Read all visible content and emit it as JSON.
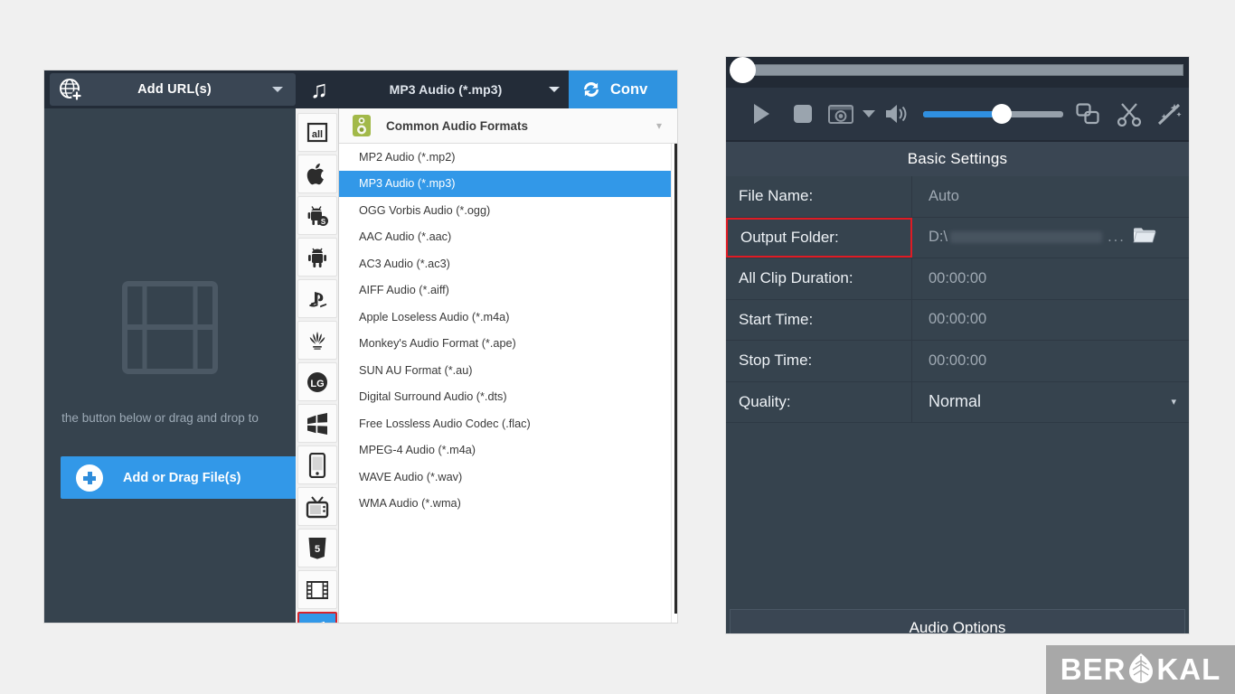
{
  "left_window": {
    "add_url_button": {
      "label": "Add URL(s)",
      "icon": "globe-add-icon",
      "caret": "chevron-down-icon"
    },
    "format_bar": {
      "icon": "music-note-icon",
      "selected_format": "MP3 Audio (*.mp3)",
      "caret": "chevron-down-icon",
      "convert_label": "Conv",
      "convert_icon": "sync-refresh-icon",
      "convert_color": "#2f93e0"
    },
    "dropzone": {
      "icon": "film-strip-icon",
      "hint_text": "the button below or drag and drop to",
      "add_button_label": "Add or Drag File(s)",
      "add_button_color": "#3298e8"
    },
    "category_rail": [
      {
        "name": "all-formats",
        "icon": "all-icon",
        "selected": false
      },
      {
        "name": "apple",
        "icon": "apple-icon",
        "selected": false
      },
      {
        "name": "samsung",
        "icon": "samsung-android-icon",
        "selected": false
      },
      {
        "name": "android",
        "icon": "android-icon",
        "selected": false
      },
      {
        "name": "playstation",
        "icon": "playstation-icon",
        "selected": false
      },
      {
        "name": "huawei",
        "icon": "huawei-icon",
        "selected": false
      },
      {
        "name": "lg",
        "icon": "lg-icon",
        "selected": false
      },
      {
        "name": "windows",
        "icon": "windows-flag-icon",
        "selected": false
      },
      {
        "name": "mobile-phone",
        "icon": "smartphone-icon",
        "selected": false
      },
      {
        "name": "tv",
        "icon": "television-icon",
        "selected": false
      },
      {
        "name": "html5",
        "icon": "html5-icon",
        "selected": false
      },
      {
        "name": "video",
        "icon": "film-strip-icon",
        "selected": false
      },
      {
        "name": "audio",
        "icon": "music-note-icon",
        "selected": true
      }
    ],
    "format_group": {
      "title": "Common Audio Formats",
      "icon": "green-speaker-icon",
      "collapse_caret": "chevron-down-icon"
    },
    "formats": [
      {
        "label": "MP2 Audio (*.mp2)",
        "selected": false
      },
      {
        "label": "MP3 Audio (*.mp3)",
        "selected": true
      },
      {
        "label": "OGG Vorbis Audio (*.ogg)",
        "selected": false
      },
      {
        "label": "AAC Audio (*.aac)",
        "selected": false
      },
      {
        "label": "AC3 Audio (*.ac3)",
        "selected": false
      },
      {
        "label": "AIFF Audio (*.aiff)",
        "selected": false
      },
      {
        "label": "Apple Loseless Audio (*.m4a)",
        "selected": false
      },
      {
        "label": "Monkey's Audio Format (*.ape)",
        "selected": false
      },
      {
        "label": "SUN AU Format (*.au)",
        "selected": false
      },
      {
        "label": "Digital Surround Audio (*.dts)",
        "selected": false
      },
      {
        "label": "Free Lossless Audio Codec (.flac)",
        "selected": false
      },
      {
        "label": "MPEG-4 Audio (*.m4a)",
        "selected": false
      },
      {
        "label": "WAVE Audio (*.wav)",
        "selected": false
      },
      {
        "label": "WMA Audio (*.wma)",
        "selected": false
      }
    ]
  },
  "right_window": {
    "transport": {
      "play": "play-icon",
      "stop": "stop-icon",
      "snapshot": "camera-snapshot-icon",
      "snapshot_caret": "chevron-down-icon",
      "volume": "speaker-volume-icon",
      "volume_level": "57",
      "merge": "merge-clips-icon",
      "cut": "scissors-cut-icon",
      "effects": "magic-wand-icon",
      "accent_color": "#2f8fe0"
    },
    "section_title": "Basic Settings",
    "settings": [
      {
        "label": "File Name:",
        "value": "Auto",
        "highlight": false,
        "type": "text"
      },
      {
        "label": "Output Folder:",
        "value": "D:\\",
        "value_redacted": true,
        "ellipsis": "...",
        "browse_icon": "folder-open-icon",
        "highlight": true,
        "highlight_color": "#e01b24",
        "type": "path"
      },
      {
        "label": "All Clip Duration:",
        "value": "00:00:00",
        "highlight": false,
        "type": "text"
      },
      {
        "label": "Start Time:",
        "value": "00:00:00",
        "highlight": false,
        "type": "text"
      },
      {
        "label": "Stop Time:",
        "value": "00:00:00",
        "highlight": false,
        "type": "text"
      },
      {
        "label": "Quality:",
        "value": "Normal",
        "highlight": false,
        "type": "select",
        "caret": "chevron-down-icon"
      }
    ],
    "footer_button": "Audio Options"
  },
  "watermark": {
    "text_before": "BER",
    "text_after": "KAL",
    "logo": "leaf-icon"
  }
}
